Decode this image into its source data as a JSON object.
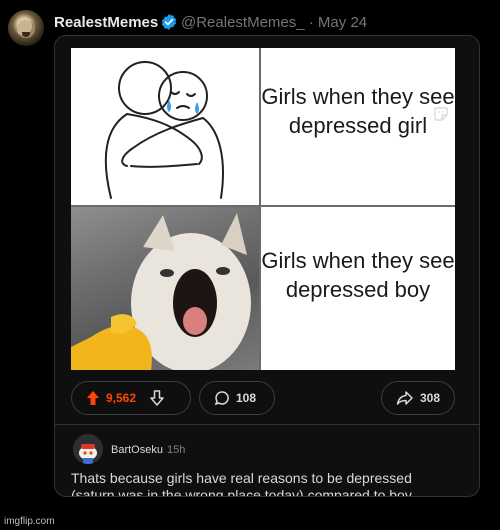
{
  "tweet": {
    "display_name": "RealestMemes",
    "handle_and_date": "@RealestMemes_ · May 24",
    "avatar_icon": "avatar-photo",
    "verified_icon": "verified-badge-icon",
    "verified_color": "#1d9bf0"
  },
  "meme": {
    "top_caption": "Girls when they see depressed girl",
    "bottom_caption": "Girls when they see depressed boy"
  },
  "actions": {
    "upvote_icon": "upvote-arrow-icon",
    "upvote_color": "#ff4500",
    "vote_count": "9,562",
    "downvote_icon": "downvote-arrow-icon",
    "comment_icon": "comment-bubble-icon",
    "comment_count": "108",
    "share_icon": "share-arrow-icon",
    "share_count": "308"
  },
  "comment": {
    "username": "BartOseku",
    "age": "15h",
    "body": "Thats because girls have real reasons to be depressed (saturn was in the wrong place today) compared to boy (penis stuck on prongles can)"
  },
  "watermark": "imgflip.com"
}
